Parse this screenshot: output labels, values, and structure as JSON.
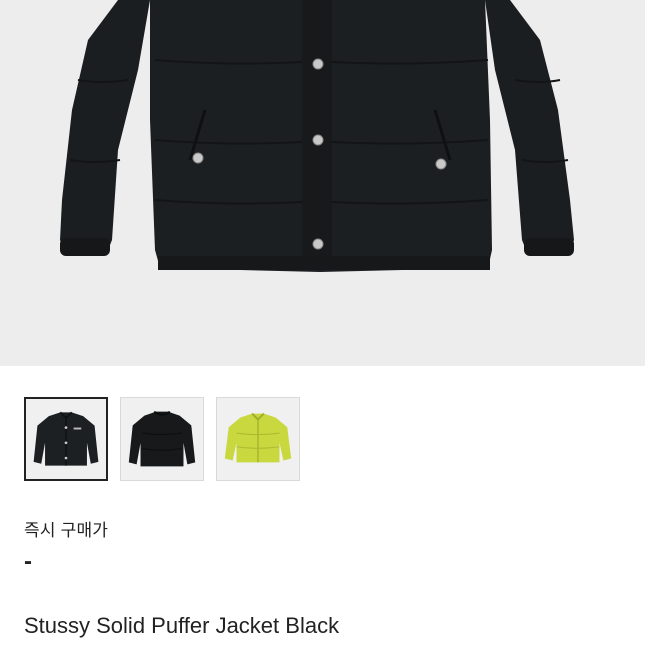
{
  "product": {
    "title": "Stussy Solid Puffer Jacket Black",
    "price_label": "즉시 구매가",
    "price_value": "-"
  },
  "gallery": {
    "thumbnails": [
      {
        "color": "black",
        "selected": true
      },
      {
        "color": "black",
        "selected": false
      },
      {
        "color": "lime",
        "selected": false
      }
    ]
  },
  "colors": {
    "hero_background": "#ededed",
    "jacket_black": "#1a1d1f",
    "jacket_lime": "#c6d63d",
    "text": "#222222"
  }
}
